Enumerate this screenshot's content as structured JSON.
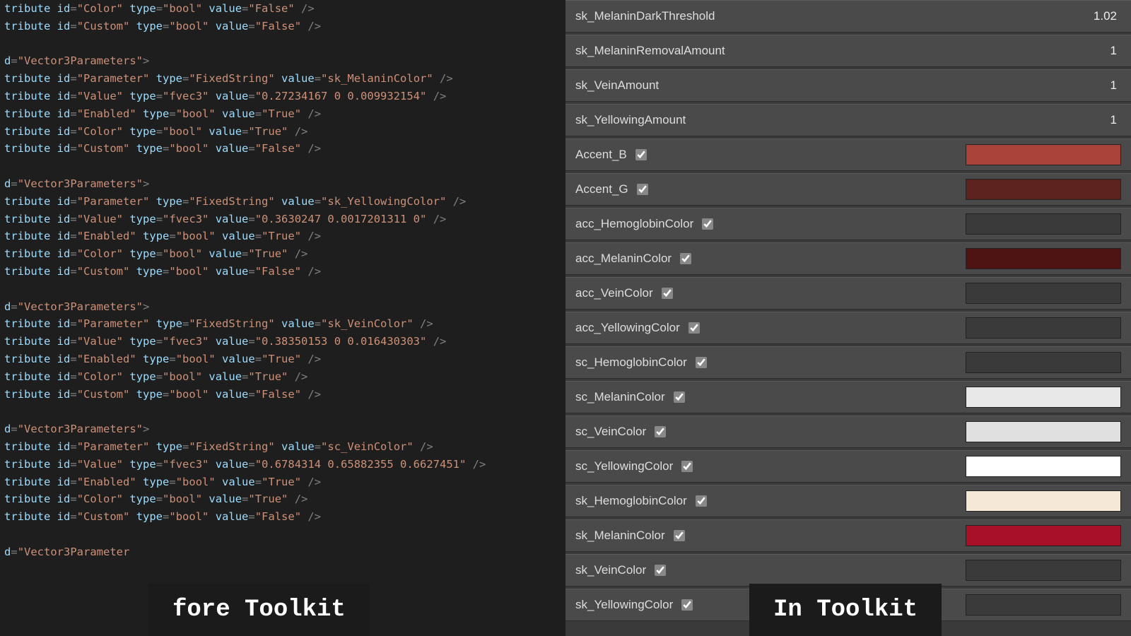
{
  "captions": {
    "left": "fore Toolkit",
    "right": "In Toolkit"
  },
  "xml": {
    "lines": [
      {
        "kind": "attr",
        "id": "Color",
        "type": "bool",
        "value": "False"
      },
      {
        "kind": "attr",
        "id": "Custom",
        "type": "bool",
        "value": "False"
      },
      {
        "kind": "blank"
      },
      {
        "kind": "node",
        "d": "Vector3Parameters"
      },
      {
        "kind": "attr",
        "id": "Parameter",
        "type": "FixedString",
        "value": "sk_MelaninColor"
      },
      {
        "kind": "attr",
        "id": "Value",
        "type": "fvec3",
        "value": "0.27234167 0 0.009932154"
      },
      {
        "kind": "attr",
        "id": "Enabled",
        "type": "bool",
        "value": "True"
      },
      {
        "kind": "attr",
        "id": "Color",
        "type": "bool",
        "value": "True"
      },
      {
        "kind": "attr",
        "id": "Custom",
        "type": "bool",
        "value": "False"
      },
      {
        "kind": "blank"
      },
      {
        "kind": "node",
        "d": "Vector3Parameters"
      },
      {
        "kind": "attr",
        "id": "Parameter",
        "type": "FixedString",
        "value": "sk_YellowingColor"
      },
      {
        "kind": "attr",
        "id": "Value",
        "type": "fvec3",
        "value": "0.3630247 0.0017201311 0"
      },
      {
        "kind": "attr",
        "id": "Enabled",
        "type": "bool",
        "value": "True"
      },
      {
        "kind": "attr",
        "id": "Color",
        "type": "bool",
        "value": "True"
      },
      {
        "kind": "attr",
        "id": "Custom",
        "type": "bool",
        "value": "False"
      },
      {
        "kind": "blank"
      },
      {
        "kind": "node",
        "d": "Vector3Parameters"
      },
      {
        "kind": "attr",
        "id": "Parameter",
        "type": "FixedString",
        "value": "sk_VeinColor"
      },
      {
        "kind": "attr",
        "id": "Value",
        "type": "fvec3",
        "value": "0.38350153 0 0.016430303"
      },
      {
        "kind": "attr",
        "id": "Enabled",
        "type": "bool",
        "value": "True"
      },
      {
        "kind": "attr",
        "id": "Color",
        "type": "bool",
        "value": "True"
      },
      {
        "kind": "attr",
        "id": "Custom",
        "type": "bool",
        "value": "False"
      },
      {
        "kind": "blank"
      },
      {
        "kind": "node",
        "d": "Vector3Parameters"
      },
      {
        "kind": "attr",
        "id": "Parameter",
        "type": "FixedString",
        "value": "sc_VeinColor"
      },
      {
        "kind": "attr",
        "id": "Value",
        "type": "fvec3",
        "value": "0.6784314 0.65882355 0.6627451"
      },
      {
        "kind": "attr",
        "id": "Enabled",
        "type": "bool",
        "value": "True"
      },
      {
        "kind": "attr",
        "id": "Color",
        "type": "bool",
        "value": "True"
      },
      {
        "kind": "attr",
        "id": "Custom",
        "type": "bool",
        "value": "False"
      },
      {
        "kind": "blank"
      },
      {
        "kind": "node-partial",
        "text": "d=\"Vector3Parameter"
      }
    ]
  },
  "props": [
    {
      "label": "sk_MelaninDarkThreshold",
      "kind": "num",
      "value": "1.02"
    },
    {
      "label": "sk_MelaninRemovalAmount",
      "kind": "num",
      "value": "1"
    },
    {
      "label": "sk_VeinAmount",
      "kind": "num",
      "value": "1"
    },
    {
      "label": "sk_YellowingAmount",
      "kind": "num",
      "value": "1"
    },
    {
      "label": "Accent_B",
      "kind": "color",
      "checked": true,
      "color": "#a94238"
    },
    {
      "label": "Accent_G",
      "kind": "color",
      "checked": true,
      "color": "#5c231e"
    },
    {
      "label": "acc_HemoglobinColor",
      "kind": "color",
      "checked": true,
      "color": "#3a3a3a"
    },
    {
      "label": "acc_MelaninColor",
      "kind": "color",
      "checked": true,
      "color": "#4e1414"
    },
    {
      "label": "acc_VeinColor",
      "kind": "color",
      "checked": true,
      "color": "#3a3a3a"
    },
    {
      "label": "acc_YellowingColor",
      "kind": "color",
      "checked": true,
      "color": "#3a3a3a"
    },
    {
      "label": "sc_HemoglobinColor",
      "kind": "color",
      "checked": true,
      "color": "#3a3a3a"
    },
    {
      "label": "sc_MelaninColor",
      "kind": "color",
      "checked": true,
      "color": "#e8e8e8"
    },
    {
      "label": "sc_VeinColor",
      "kind": "color",
      "checked": true,
      "color": "#e0e0e0"
    },
    {
      "label": "sc_YellowingColor",
      "kind": "color",
      "checked": true,
      "color": "#ffffff"
    },
    {
      "label": "sk_HemoglobinColor",
      "kind": "color",
      "checked": true,
      "color": "#f5e8d6"
    },
    {
      "label": "sk_MelaninColor",
      "kind": "color",
      "checked": true,
      "color": "#a8102a"
    },
    {
      "label": "sk_VeinColor",
      "kind": "color",
      "checked": true,
      "color": "#3a3a3a"
    },
    {
      "label": "sk_YellowingColor",
      "kind": "color",
      "checked": true,
      "color": "#3a3a3a"
    }
  ]
}
